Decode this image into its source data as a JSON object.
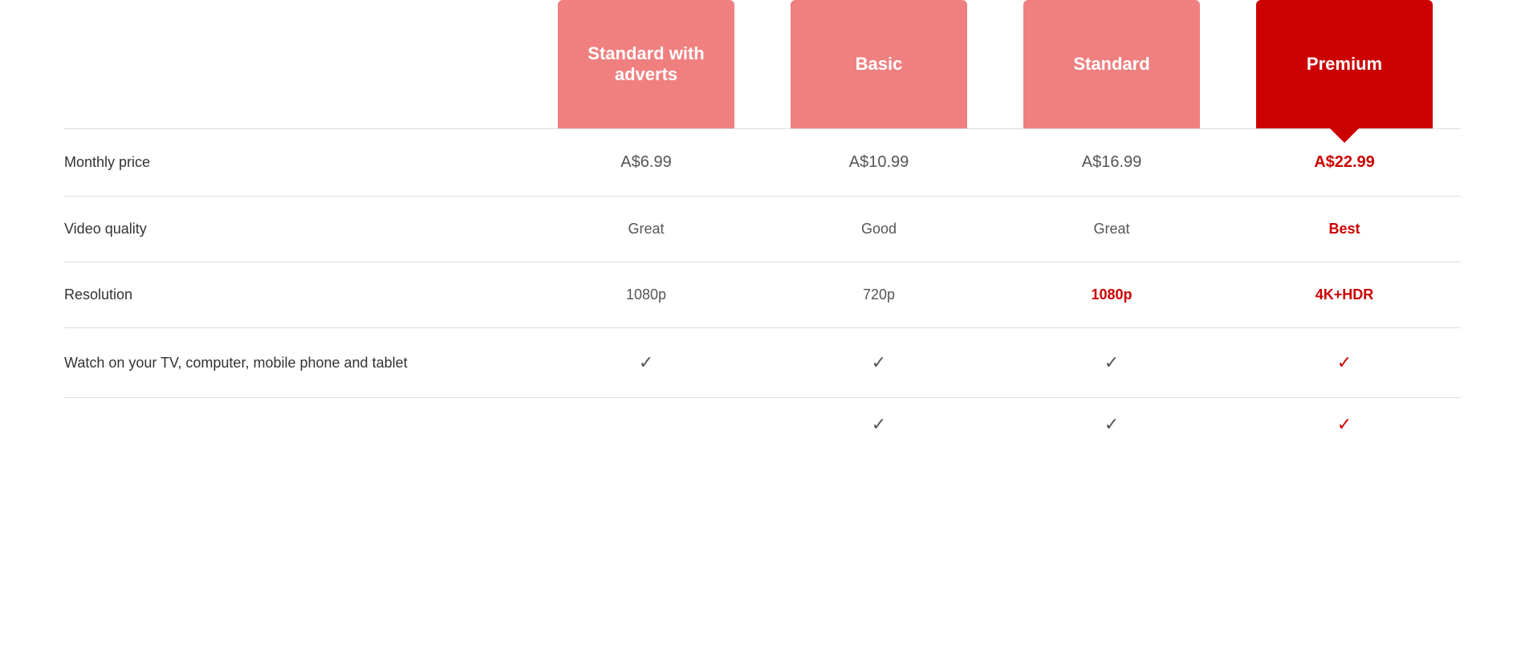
{
  "plans": [
    {
      "id": "standard-adverts",
      "label": "Standard with adverts",
      "colorClass": "standard-adverts",
      "price": "A$6.99",
      "priceHighlighted": false,
      "videoQuality": "Great",
      "videoQualityHighlighted": false,
      "resolution": "1080p",
      "resolutionHighlighted": false,
      "watchDevices": true,
      "watchDevicesHighlighted": false
    },
    {
      "id": "basic",
      "label": "Basic",
      "colorClass": "basic",
      "price": "A$10.99",
      "priceHighlighted": false,
      "videoQuality": "Good",
      "videoQualityHighlighted": false,
      "resolution": "720p",
      "resolutionHighlighted": false,
      "watchDevices": true,
      "watchDevicesHighlighted": false
    },
    {
      "id": "standard",
      "label": "Standard",
      "colorClass": "standard",
      "price": "A$16.99",
      "priceHighlighted": false,
      "videoQuality": "Great",
      "videoQualityHighlighted": false,
      "resolution": "1080p",
      "resolutionHighlighted": true,
      "watchDevices": true,
      "watchDevicesHighlighted": false
    },
    {
      "id": "premium",
      "label": "Premium",
      "colorClass": "premium",
      "price": "A$22.99",
      "priceHighlighted": true,
      "videoQuality": "Best",
      "videoQualityHighlighted": true,
      "resolution": "4K+HDR",
      "resolutionHighlighted": true,
      "watchDevices": true,
      "watchDevicesHighlighted": true
    }
  ],
  "rows": {
    "monthly_price_label": "Monthly price",
    "video_quality_label": "Video quality",
    "resolution_label": "Resolution",
    "watch_devices_label": "Watch on your TV, computer, mobile phone and tablet"
  }
}
